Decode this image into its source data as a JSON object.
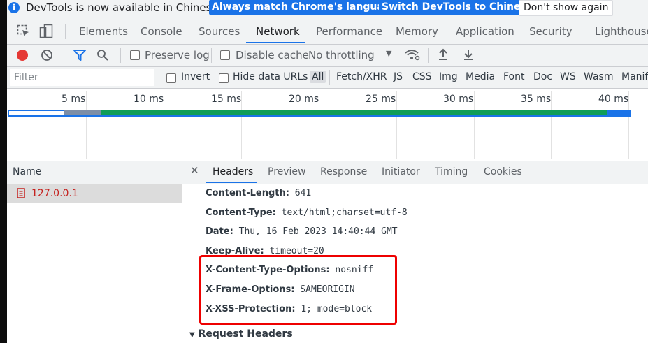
{
  "infobar": {
    "message": "DevTools is now available in Chinese!",
    "match_language": "Always match Chrome's language",
    "switch_language": "Switch DevTools to Chinese",
    "dismiss": "Don't show again"
  },
  "tabs": [
    "Elements",
    "Console",
    "Sources",
    "Network",
    "Performance",
    "Memory",
    "Application",
    "Security",
    "Lighthouse"
  ],
  "active_tab": "Network",
  "toolbar": {
    "preserve_log": "Preserve log",
    "disable_cache": "Disable cache",
    "throttling": "No throttling"
  },
  "filter": {
    "placeholder": "Filter",
    "invert": "Invert",
    "hide_data_urls": "Hide data URLs",
    "types": [
      "All",
      "Fetch/XHR",
      "JS",
      "CSS",
      "Img",
      "Media",
      "Font",
      "Doc",
      "WS",
      "Wasm",
      "Manif"
    ],
    "selected_type": "All"
  },
  "timeline": {
    "ticks": [
      "5 ms",
      "10 ms",
      "15 ms",
      "20 ms",
      "25 ms",
      "30 ms",
      "35 ms",
      "40 ms"
    ]
  },
  "requests": {
    "column_name": "Name",
    "items": [
      {
        "name": "127.0.0.1",
        "selected": true
      }
    ]
  },
  "details": {
    "tabs": [
      "Headers",
      "Preview",
      "Response",
      "Initiator",
      "Timing",
      "Cookies"
    ],
    "active_tab": "Headers",
    "response_headers": [
      {
        "name": "Content-Length:",
        "value": "641"
      },
      {
        "name": "Content-Type:",
        "value": "text/html;charset=utf-8"
      },
      {
        "name": "Date:",
        "value": "Thu, 16 Feb 2023 14:40:44 GMT"
      },
      {
        "name": "Keep-Alive:",
        "value": "timeout=20"
      },
      {
        "name": "X-Content-Type-Options:",
        "value": "nosniff"
      },
      {
        "name": "X-Frame-Options:",
        "value": "SAMEORIGIN"
      },
      {
        "name": "X-XSS-Protection:",
        "value": "1; mode=block"
      }
    ],
    "request_headers_section": "Request Headers"
  },
  "colors": {
    "accent": "#1a73e8",
    "record": "#e53935",
    "highlight_box": "#ee0000",
    "request_red": "#c5221f"
  }
}
